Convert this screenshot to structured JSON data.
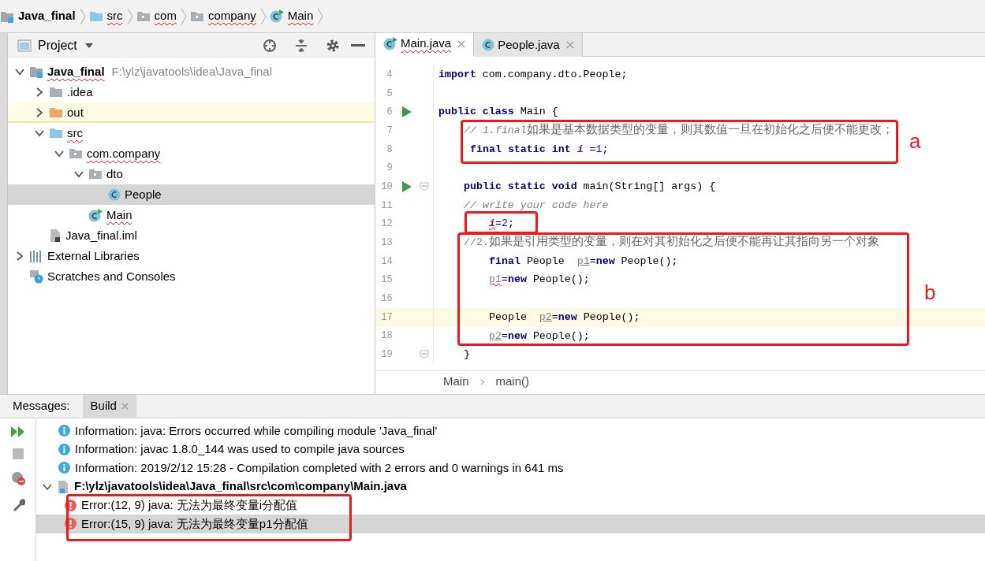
{
  "breadcrumb": [
    {
      "label": "Java_final",
      "kind": "module",
      "misspelled": false
    },
    {
      "label": "src",
      "kind": "source-folder",
      "misspelled": true
    },
    {
      "label": "com",
      "kind": "package",
      "misspelled": true
    },
    {
      "label": "company",
      "kind": "package",
      "misspelled": true
    },
    {
      "label": "Main",
      "kind": "main-class",
      "misspelled": true
    }
  ],
  "project_panel": {
    "title": "Project",
    "tree": [
      {
        "label": "Java_final",
        "hint": "F:\\ylz\\javatools\\idea\\Java_final",
        "kind": "module",
        "expanded": true,
        "selected": false,
        "highlighted": false,
        "misspelled": true,
        "children": [
          {
            "label": ".idea",
            "kind": "folder",
            "expanded": false,
            "selected": false,
            "highlighted": false,
            "misspelled": false
          },
          {
            "label": "out",
            "kind": "excluded-folder",
            "expanded": false,
            "selected": false,
            "highlighted": true,
            "misspelled": false
          },
          {
            "label": "src",
            "kind": "source-folder",
            "expanded": true,
            "selected": false,
            "highlighted": false,
            "misspelled": true,
            "children": [
              {
                "label": "com.company",
                "kind": "package",
                "expanded": true,
                "selected": false,
                "highlighted": false,
                "misspelled": true,
                "children": [
                  {
                    "label": "dto",
                    "kind": "package",
                    "expanded": true,
                    "selected": false,
                    "highlighted": false,
                    "misspelled": false,
                    "children": [
                      {
                        "label": "People",
                        "kind": "class",
                        "selected": true,
                        "highlighted": false,
                        "misspelled": false
                      }
                    ]
                  },
                  {
                    "label": "Main",
                    "kind": "main-class",
                    "selected": false,
                    "highlighted": false,
                    "misspelled": true
                  }
                ]
              }
            ]
          },
          {
            "label": "Java_final.iml",
            "kind": "iml",
            "selected": false,
            "highlighted": false,
            "misspelled": false
          }
        ]
      },
      {
        "label": "External Libraries",
        "kind": "libraries",
        "expanded": false,
        "selected": false,
        "highlighted": false,
        "misspelled": false
      },
      {
        "label": "Scratches and Consoles",
        "kind": "scratches",
        "selected": false,
        "highlighted": false,
        "misspelled": false
      }
    ]
  },
  "editor": {
    "tabs": [
      {
        "label": "Main.java",
        "kind": "main-class",
        "selected": true
      },
      {
        "label": "People.java",
        "kind": "class",
        "selected": false
      }
    ],
    "lines": [
      {
        "number": "4",
        "tokens": [
          {
            "kind": "kw",
            "text": "import"
          },
          {
            "kind": "plain",
            "text": " com.company.dto.People;"
          }
        ]
      },
      {
        "number": "5"
      },
      {
        "number": "6",
        "run": true,
        "tokens": [
          {
            "kind": "kw",
            "text": "public class"
          },
          {
            "kind": "plain",
            "text": " Main {"
          }
        ]
      },
      {
        "number": "7",
        "tokens": [
          {
            "kind": "comment",
            "text": "    // 1.final"
          },
          {
            "kind": "comment-cjk",
            "text": "如果是基本数据类型的变量，则其数值一旦在初始化之后便不能更改；"
          }
        ]
      },
      {
        "number": "8",
        "tokens": [
          {
            "kind": "kw",
            "text": "     final static int "
          },
          {
            "kind": "field",
            "text": "i"
          },
          {
            "kind": "plain",
            "text": " ="
          },
          {
            "kind": "num",
            "text": "1"
          },
          {
            "kind": "plain",
            "text": ";"
          }
        ]
      },
      {
        "number": "9"
      },
      {
        "number": "10",
        "run": true,
        "fold": true,
        "tokens": [
          {
            "kind": "kw",
            "text": "    public static void"
          },
          {
            "kind": "plain",
            "text": " main(String[] args) {"
          }
        ]
      },
      {
        "number": "11",
        "tokens": [
          {
            "kind": "comment",
            "text": "    // write your code here"
          }
        ]
      },
      {
        "number": "12",
        "tokens": [
          {
            "kind": "field-error",
            "text": "        i"
          },
          {
            "kind": "plain",
            "text": "="
          },
          {
            "kind": "num",
            "text": "2"
          },
          {
            "kind": "plain",
            "text": ";"
          }
        ]
      },
      {
        "number": "13",
        "tokens": [
          {
            "kind": "comment-plain",
            "text": "    //2."
          },
          {
            "kind": "comment-cjk",
            "text": "如果是引用类型的变量，则在对其初始化之后便不能再让其指向另一个对象"
          }
        ]
      },
      {
        "number": "14",
        "tokens": [
          {
            "kind": "kw",
            "text": "        final"
          },
          {
            "kind": "plain",
            "text": " People  "
          },
          {
            "kind": "var",
            "text": "p1"
          },
          {
            "kind": "plain",
            "text": "="
          },
          {
            "kind": "kw",
            "text": "new"
          },
          {
            "kind": "plain",
            "text": " People();"
          }
        ]
      },
      {
        "number": "15",
        "tokens": [
          {
            "kind": "var-error",
            "text": "        p1"
          },
          {
            "kind": "plain",
            "text": "="
          },
          {
            "kind": "kw",
            "text": "new"
          },
          {
            "kind": "plain",
            "text": " People();"
          }
        ]
      },
      {
        "number": "16"
      },
      {
        "number": "17",
        "current": true,
        "tokens": [
          {
            "kind": "plain",
            "text": "        People  "
          },
          {
            "kind": "var",
            "text": "p2"
          },
          {
            "kind": "plain",
            "text": "="
          },
          {
            "kind": "kw",
            "text": "new"
          },
          {
            "kind": "plain",
            "text": " People();"
          }
        ]
      },
      {
        "number": "18",
        "tokens": [
          {
            "kind": "var",
            "text": "        p2"
          },
          {
            "kind": "plain",
            "text": "="
          },
          {
            "kind": "kw",
            "text": "new"
          },
          {
            "kind": "plain",
            "text": " People();"
          }
        ]
      },
      {
        "number": "19",
        "fold": true,
        "tokens": [
          {
            "kind": "plain",
            "text": "    }"
          }
        ]
      }
    ],
    "breadcrumb": [
      "Main",
      "main()"
    ]
  },
  "annotations": [
    {
      "kind": "labeled-box",
      "label": "a"
    },
    {
      "kind": "box"
    },
    {
      "kind": "labeled-box",
      "label": "b"
    },
    {
      "kind": "box"
    }
  ],
  "messages_panel": {
    "title": "Messages:",
    "tabs": [
      {
        "label": "Build",
        "selected": true
      }
    ],
    "messages": [
      {
        "kind": "info",
        "text": "Information: java: Errors occurred while compiling module 'Java_final'",
        "selected": false
      },
      {
        "kind": "info",
        "text": "Information: javac 1.8.0_144 was used to compile java sources",
        "selected": false
      },
      {
        "kind": "info",
        "text": "Information: 2019/2/12 15:28 - Compilation completed with 2 errors and 0 warnings in 641 ms",
        "selected": false
      },
      {
        "kind": "file",
        "text": "F:\\ylz\\javatools\\idea\\Java_final\\src\\com\\company\\Main.java",
        "selected": false,
        "children": [
          {
            "kind": "error",
            "text": "Error:(12, 9)  java: 无法为最终变量i分配值",
            "selected": false
          },
          {
            "kind": "error",
            "text": "Error:(15, 9)  java: 无法为最终变量p1分配值",
            "selected": true
          }
        ]
      }
    ]
  }
}
